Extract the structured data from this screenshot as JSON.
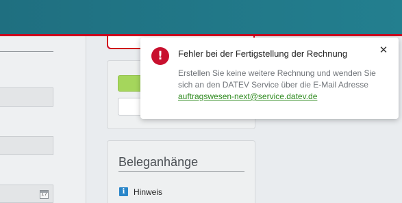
{
  "colors": {
    "header": "#237f8f",
    "accent_red": "#d0021b",
    "error_icon": "#c8102e",
    "link_green": "#2e8a1f",
    "button_green": "#a5d65c",
    "info_icon": "#2a86c9"
  },
  "left_panel": {
    "calendar_icon": "calendar-icon",
    "calendar_glyph": "17"
  },
  "beleg_panel": {
    "title": "Beleganhänge",
    "hint": {
      "icon": "info-icon",
      "icon_glyph": "i",
      "label": "Hinweis"
    }
  },
  "notification": {
    "icon": "error-icon",
    "icon_glyph": "!",
    "title": "Fehler bei der Fertigstellung der Rechnung",
    "message_line1": "Erstellen Sie keine weitere Rechnung und wenden Sie",
    "message_line2": "sich an den DATEV Service über die E-Mail Adresse",
    "email_link": "auftragswesen-next@service.datev.de",
    "close_glyph": "✕"
  }
}
